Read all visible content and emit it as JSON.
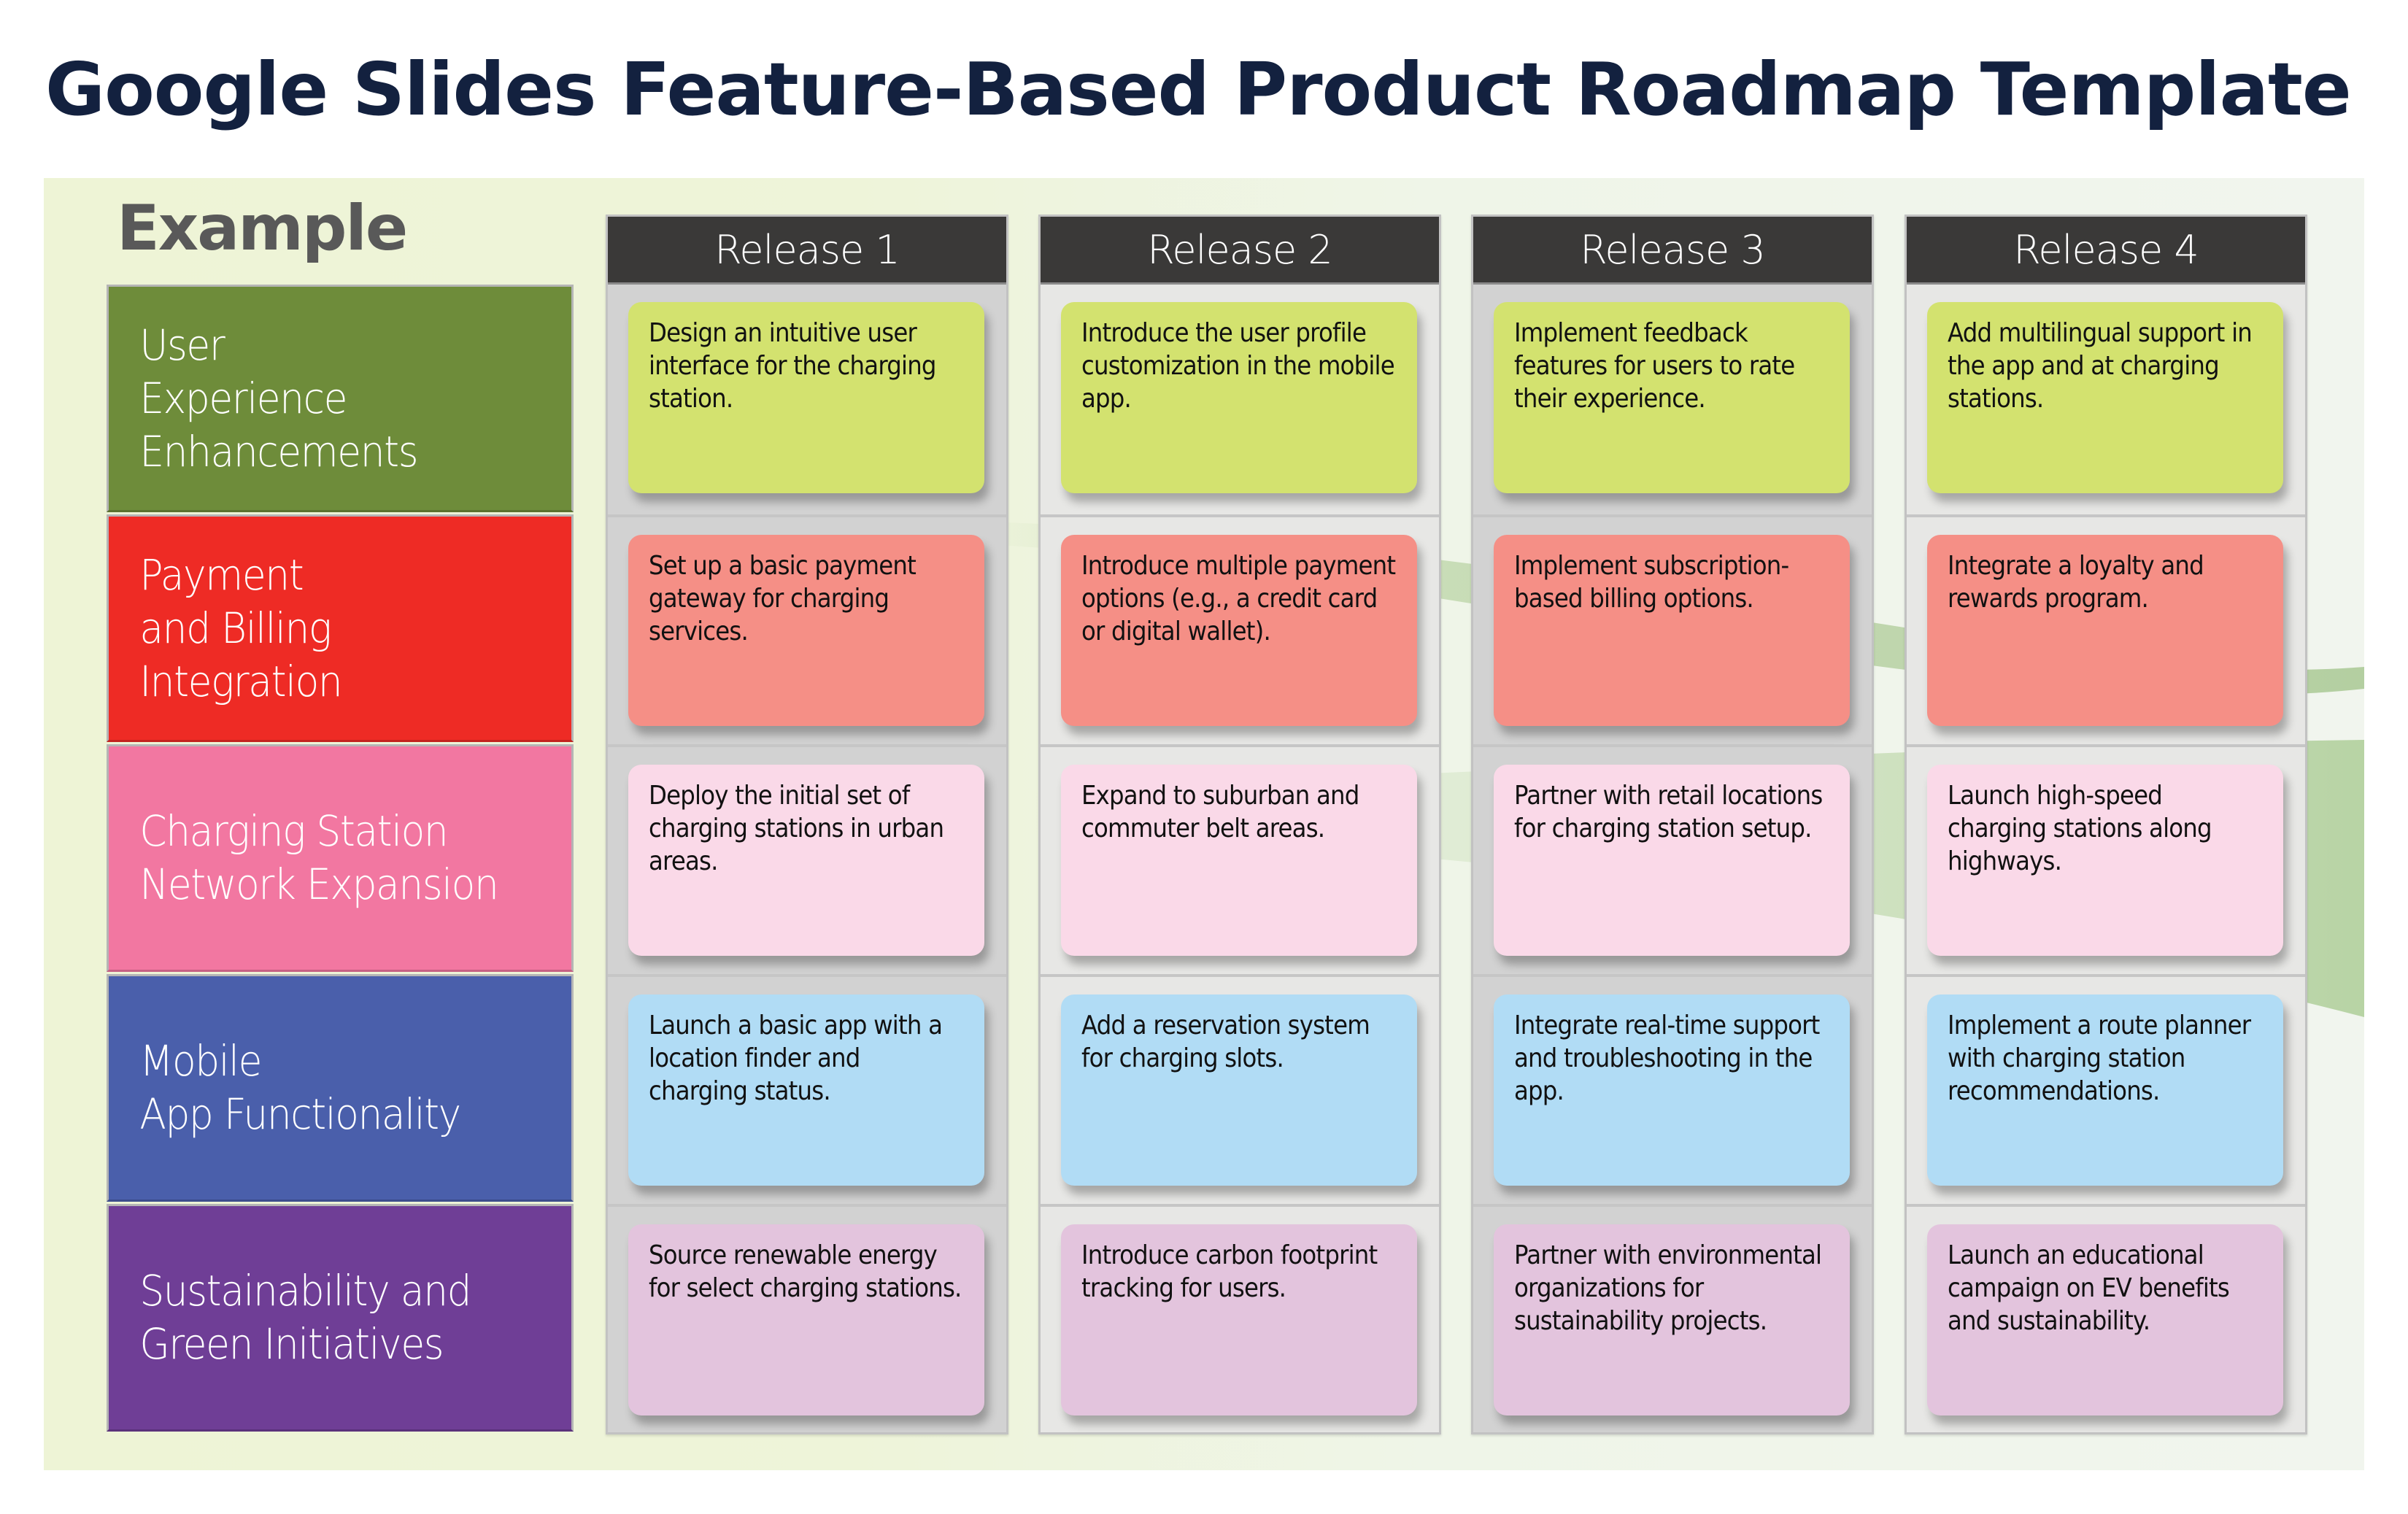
{
  "title": "Google Slides Feature-Based Product Roadmap Template",
  "example_label": "Example",
  "colors": {
    "title": "#13213f",
    "release_header": "#3a3938"
  },
  "releases": [
    {
      "label": "Release 1"
    },
    {
      "label": "Release 2"
    },
    {
      "label": "Release 3"
    },
    {
      "label": "Release 4"
    }
  ],
  "categories": [
    {
      "label": "User\nExperience\nEnhancements",
      "color": "#6e8c3a",
      "card_color": "#d3e26f",
      "items": [
        "Design an intuitive user interface for the charging station.",
        "Introduce the user profile customization in the mobile app.",
        "Implement feedback features for users to rate their experience.",
        "Add multilingual support in the app and at charging stations."
      ]
    },
    {
      "label": "Payment\nand Billing\nIntegration",
      "color": "#ee2b25",
      "card_color": "#f58f86",
      "items": [
        "Set up a basic payment gateway for charging services.",
        "Introduce multiple payment options (e.g., a credit card or digital wallet).",
        "Implement subscription-based billing options.",
        "Integrate a loyalty and rewards program."
      ]
    },
    {
      "label": "Charging Station\nNetwork Expansion",
      "color": "#f277a1",
      "card_color": "#fad9e8",
      "items": [
        "Deploy the initial set of charging stations in urban areas.",
        "Expand to suburban and commuter belt areas.",
        "Partner with retail locations for charging station setup.",
        "Launch high-speed charging stations along highways."
      ]
    },
    {
      "label": "Mobile\nApp Functionality",
      "color": "#4a5fab",
      "card_color": "#b1dcf5",
      "items": [
        "Launch a basic app with a location finder and charging status.",
        "Add a reservation system for charging slots.",
        "Integrate real-time support and troubleshooting in the app.",
        "Implement a route planner with charging station recommendations."
      ]
    },
    {
      "label": "Sustainability and\nGreen Initiatives",
      "color": "#6f3e96",
      "card_color": "#e3c4dd",
      "items": [
        "Source renewable energy for select charging stations.",
        "Introduce carbon footprint tracking for users.",
        "Partner with environmental organizations for sustainability projects.",
        "Launch an educational campaign on EV benefits and sustainability."
      ]
    }
  ]
}
